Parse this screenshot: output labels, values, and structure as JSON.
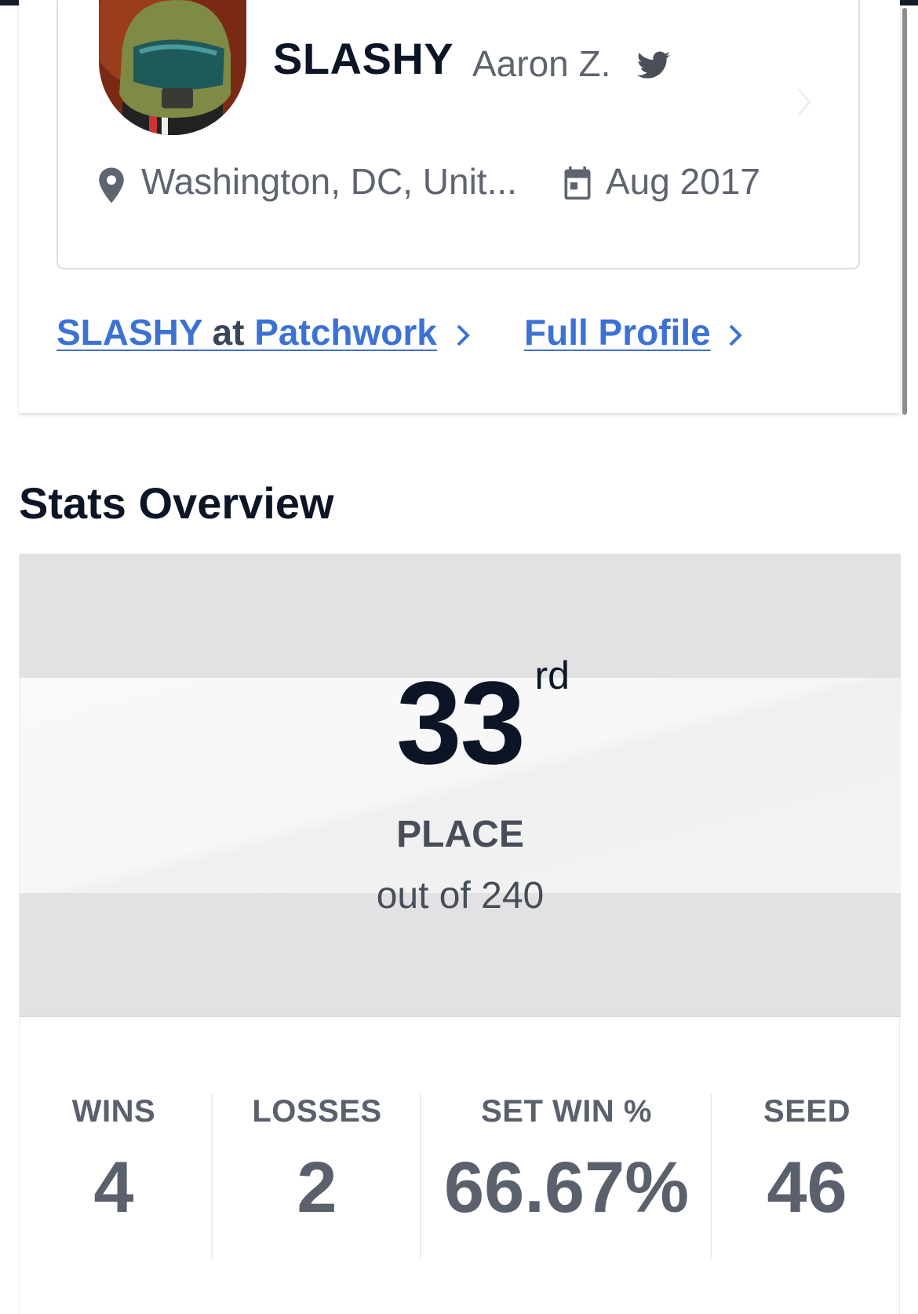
{
  "profile": {
    "gamer_tag": "SLASHY",
    "real_name": "Aaron Z.",
    "location": "Washington, DC, Unit...",
    "joined": "Aug 2017",
    "icons": [
      "twitter-icon",
      "location-pin-icon",
      "calendar-icon",
      "chevron-right-icon"
    ]
  },
  "links": {
    "event_link": {
      "tag": "SLASHY",
      "mid": " at ",
      "event": "Patchwork"
    },
    "full_profile": "Full Profile"
  },
  "stats_overview": {
    "title": "Stats Overview",
    "placement": {
      "number": "33",
      "suffix": "rd",
      "label": "PLACE",
      "total": "out of 240"
    },
    "stats": [
      {
        "label": "WINS",
        "value": "4"
      },
      {
        "label": "LOSSES",
        "value": "2"
      },
      {
        "label": "SET WIN %",
        "value": "66.67%"
      },
      {
        "label": "SEED",
        "value": "46"
      }
    ]
  },
  "colors": {
    "link": "#3c72d4",
    "heading": "#0c1526",
    "muted": "#5e6470",
    "panel": "#e2e2e4"
  }
}
